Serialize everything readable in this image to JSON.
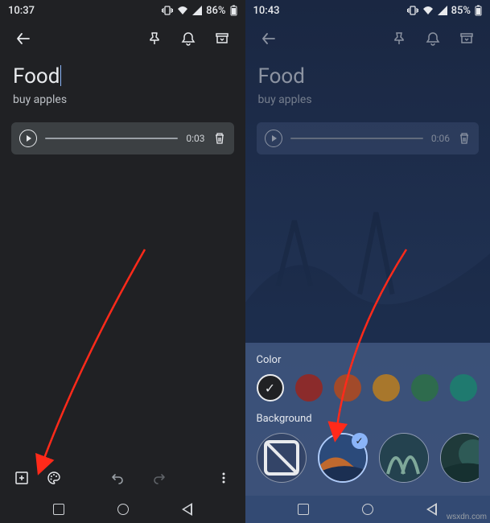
{
  "left": {
    "status": {
      "time": "10:37",
      "battery": "86%"
    },
    "note": {
      "title": "Food",
      "body": "buy apples"
    },
    "audio": {
      "duration": "0:03"
    }
  },
  "right": {
    "status": {
      "time": "10:43",
      "battery": "85%"
    },
    "note": {
      "title": "Food",
      "body": "buy apples"
    },
    "audio": {
      "duration": "0:06"
    },
    "sheet": {
      "color_label": "Color",
      "background_label": "Background",
      "colors": [
        "#202124",
        "#8b2b2b",
        "#a24a2a",
        "#a8772c",
        "#2e6b4d",
        "#1f7a6f",
        "#2a5a8a",
        "#3a4a8a"
      ],
      "selected_color_index": 0,
      "selected_bg_index": 1
    }
  },
  "watermark": "wsxdn.com"
}
